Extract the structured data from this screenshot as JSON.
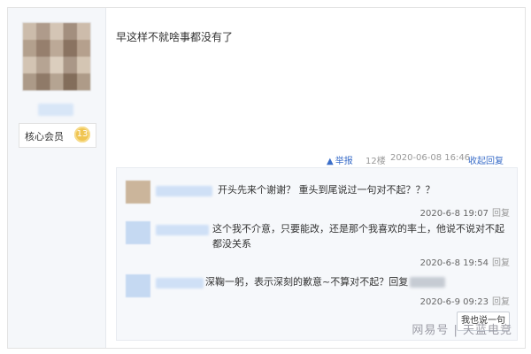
{
  "post": {
    "text": "早这样不就啥事都没有了",
    "member_label": "核心会员",
    "member_medal": "13"
  },
  "meta": {
    "report_label": "举报",
    "floor": "12楼",
    "time": "2020-06-08 16:46",
    "collapse_label": "收起回复"
  },
  "replies": [
    {
      "text": "开头先来个谢谢？ 重头到尾说过一句对不起？？？",
      "time": "2020-6-8 19:07",
      "reply_label": "回复"
    },
    {
      "text": "这个我不介意，只要能改，还是那个我喜欢的率土，他说不说对不起都没关系",
      "time": "2020-6-8 19:54",
      "reply_label": "回复"
    },
    {
      "text": "深鞠一躬，表示深刻的歉意~不算对不起？回复",
      "time": "2020-6-9 09:23",
      "reply_label": "回复"
    }
  ],
  "say_button": "我也说一句",
  "watermark": "网易号 | 天蓝电竞"
}
